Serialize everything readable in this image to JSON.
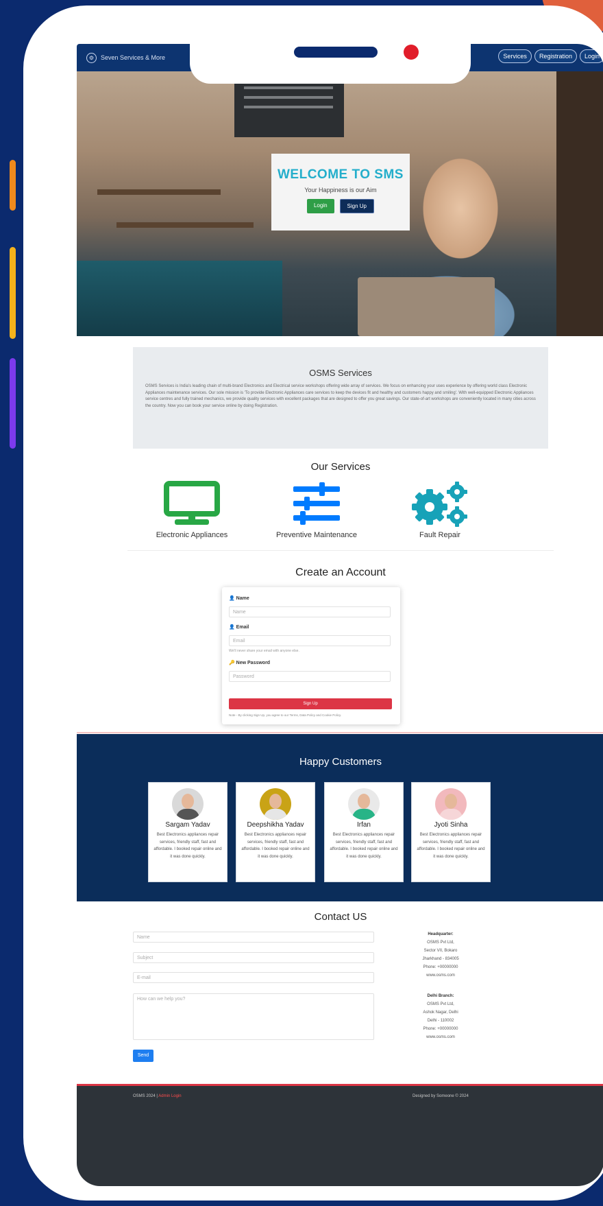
{
  "navbar": {
    "brand": "Seven Services & More",
    "links": [
      "Services",
      "Registration",
      "Login"
    ]
  },
  "hero": {
    "title": "WELCOME TO SMS",
    "subtitle": "Your Happiness is our Aim",
    "login": "Login",
    "signup": "Sign Up"
  },
  "osms": {
    "title": "OSMS Services",
    "text": "OSMS Services is India's leading chain of multi-brand Electronics and Electrical service workshops offering wide array of services. We focus on enhancing your uses experience by offering world class Electronic Appliances maintenance services. Our sole mission is 'To provide Electronic Appliances care services to keep the devices fit and healthy and customers happy and smiling'. With well-equipped Electronic Appliances service centres and fully trained mechanics, we provide quality services with excellent packages that are designed to offer you great savings. Our state-of-art workshops are conveniently located in many cities across the country. Now you can book your service online by doing Registration."
  },
  "services": {
    "title": "Our Services",
    "items": [
      {
        "label": "Electronic Appliances",
        "icon": "tv-monitor-icon",
        "color": "#28a745"
      },
      {
        "label": "Preventive Maintenance",
        "icon": "sliders-icon",
        "color": "#007bff"
      },
      {
        "label": "Fault Repair",
        "icon": "cogs-icon",
        "color": "#17a2b8"
      }
    ]
  },
  "signup": {
    "title": "Create an Account",
    "name_label": "Name",
    "name_placeholder": "Name",
    "email_label": "Email",
    "email_placeholder": "Email",
    "email_help": "We'll never share your email with anyone else.",
    "password_label": "New Password",
    "password_placeholder": "Password",
    "button": "Sign Up",
    "note": "Note - By clicking Sign Up, you agree to our Terms, Data Policy and Cookie Policy."
  },
  "customers": {
    "title": "Happy Customers",
    "items": [
      {
        "name": "Sargam Yadav",
        "text": "Best Electronics appliances repair services, friendly staff, fast and affordable. I booked repair online and it was done quickly.",
        "avatar_bg": "#d9d9d9",
        "shirt": "#555555"
      },
      {
        "name": "Deepshikha Yadav",
        "text": "Best Electronics appliances repair services, friendly staff, fast and affordable. I booked repair online and it was done quickly.",
        "avatar_bg": "#c9a316",
        "shirt": "#e6e6e6"
      },
      {
        "name": "Irfan",
        "text": "Best Electronics appliances repair services, friendly staff, fast and affordable. I booked repair online and it was done quickly.",
        "avatar_bg": "#e9e9e9",
        "shirt": "#28b487"
      },
      {
        "name": "Jyoti Sinha",
        "text": "Best Electronics appliances repair services, friendly staff, fast and affordable. I booked repair online and it was done quickly.",
        "avatar_bg": "#f2b9bd",
        "shirt": "#f6d6d8"
      }
    ]
  },
  "contact": {
    "title": "Contact US",
    "name_placeholder": "Name",
    "subject_placeholder": "Subject",
    "email_placeholder": "E-mail",
    "message_placeholder": "How can we help you?",
    "send": "Send",
    "hq": {
      "title": "Headquarter:",
      "lines": [
        "OSMS Pvt Ltd,",
        "Sector VII, Bokaro",
        "Jharkhand - 834005",
        "Phone: +00000000",
        "www.osms.com"
      ]
    },
    "branch": {
      "title": "Delhi Branch:",
      "lines": [
        "OSMS Pvt Ltd,",
        "Ashok Nagar, Delhi",
        "Delhi - 110002",
        "Phone: +00000000",
        "www.osms.com"
      ]
    }
  },
  "footer": {
    "left": "OSMS 2024 |",
    "admin": "Admin Login",
    "right": "Designed by Someone © 2024"
  }
}
